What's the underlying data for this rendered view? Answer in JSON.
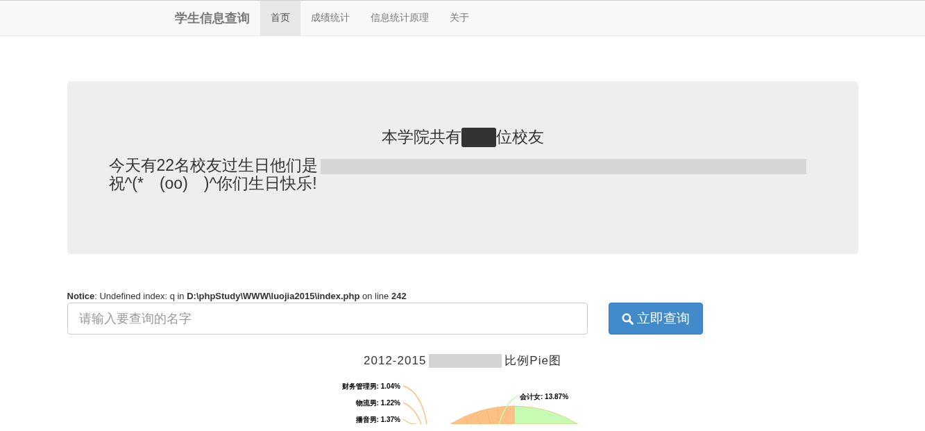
{
  "navbar": {
    "brand": "学生信息查询",
    "items": [
      {
        "label": "首页",
        "selected": true
      },
      {
        "label": "成绩统计",
        "selected": false
      },
      {
        "label": "信息统计原理",
        "selected": false
      },
      {
        "label": "关于",
        "selected": false
      }
    ]
  },
  "jumbotron": {
    "title_before": "本学院共有",
    "title_after": "位校友",
    "birthday_before": "今天有22名校友过生日他们是",
    "birthday_after": "祝^(*　(oo)　)^你们生日快乐!"
  },
  "notice": {
    "label": "Notice",
    "text_1": ": Undefined index: q in ",
    "path": "D:\\phpStudy\\WWW\\luojia2015\\index.php",
    "text_2": " on line ",
    "line": "242"
  },
  "search": {
    "placeholder": "请输入要查询的名字",
    "button": "立即查询"
  },
  "chart": {
    "title_before": "2012-2015",
    "title_after": "比例Pie图",
    "slice_labels": [
      {
        "text": "会计女: 13.87%",
        "color": "#c5fbb2"
      },
      {
        "text": "财务管理男: 1.04%",
        "color": "#fdc283"
      },
      {
        "text": "物流男: 1.22%",
        "color": "#fdc283"
      },
      {
        "text": "播音男: 1.37%",
        "color": "#fdc283"
      }
    ]
  }
}
